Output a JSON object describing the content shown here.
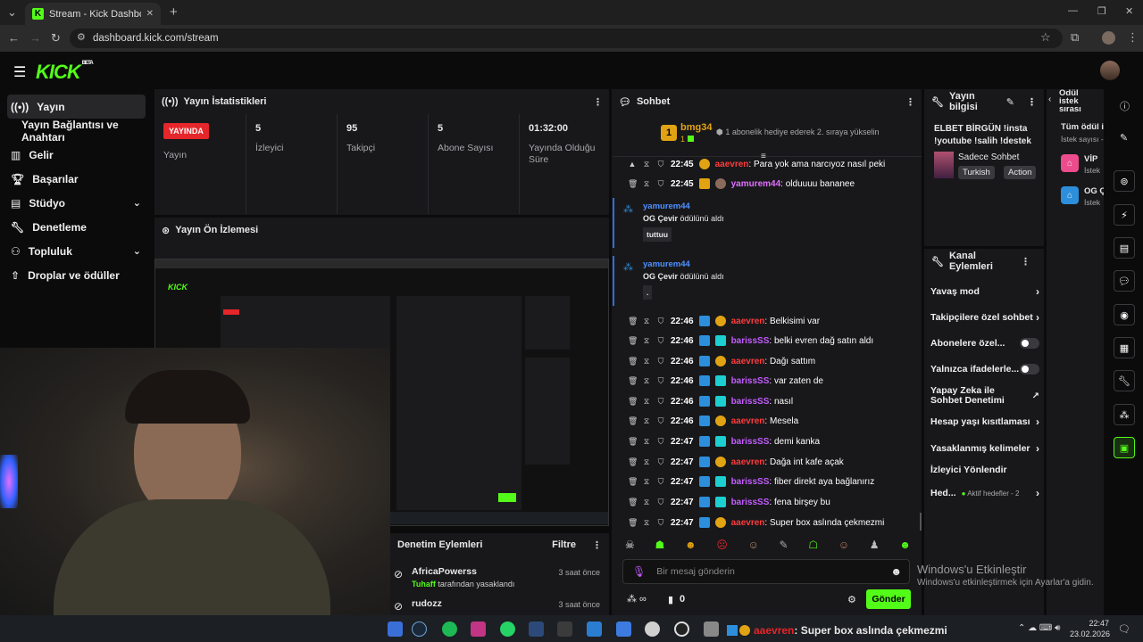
{
  "browser": {
    "tab_title": "Stream - Kick Dashboard",
    "url": "dashboard.kick.com/stream",
    "new_tab": "+",
    "minimize": "—",
    "maximize": "❐",
    "close": "✕"
  },
  "brand": {
    "logo": "KICK",
    "beta": "BETA",
    "accent": "#53fc18"
  },
  "sidebar": {
    "items": [
      {
        "label": "Yayın",
        "icon": "broadcast-icon"
      },
      {
        "label": "Yayın Bağlantısı ve Anahtarı"
      },
      {
        "label": "Gelir",
        "icon": "revenue-icon"
      },
      {
        "label": "Başarılar",
        "icon": "trophy-icon"
      },
      {
        "label": "Stüdyo",
        "icon": "studio-icon"
      },
      {
        "label": "Denetleme",
        "icon": "wrench-icon"
      },
      {
        "label": "Topluluk",
        "icon": "community-icon"
      },
      {
        "label": "Droplar ve ödüller",
        "icon": "drops-icon"
      }
    ]
  },
  "stats": {
    "title": "Yayın İstatistikleri",
    "live_badge": "YAYINDA",
    "items": [
      {
        "value": "",
        "label": "Yayın"
      },
      {
        "value": "5",
        "label": "İzleyici"
      },
      {
        "value": "95",
        "label": "Takipçi"
      },
      {
        "value": "5",
        "label": "Abone Sayısı"
      },
      {
        "value": "01:32:00",
        "label": "Yayında Olduğu Süre"
      }
    ]
  },
  "preview": {
    "title": "Yayın Ön İzlemesi"
  },
  "moderation": {
    "title": "Denetim Eylemleri",
    "filter": "Filtre",
    "entries": [
      {
        "user": "AfricaPowerss",
        "by": "Tuhaff",
        "action": "tarafından yasaklandı",
        "time": "3 saat önce"
      },
      {
        "user": "rudozz",
        "time": "3 saat önce"
      }
    ]
  },
  "chat": {
    "title": "Sohbet",
    "pinned": {
      "rank": "1",
      "user": "bmg34",
      "count": "1",
      "text": "1 abonelik hediye ederek 2. sıraya yükselin"
    },
    "messages": [
      {
        "time": "22:45",
        "user": "aaevren",
        "text": "Para yok ama narcıyoz nasıl peki"
      },
      {
        "time": "22:45",
        "user": "yamurem44",
        "text": "olduuuu bananee"
      },
      {
        "time": "22:46",
        "user": "aaevren",
        "text": "Belkisimi var"
      },
      {
        "time": "22:46",
        "user": "barissSS",
        "text": "belki evren dağ satın aldı"
      },
      {
        "time": "22:46",
        "user": "aaevren",
        "text": "Dağı sattım"
      },
      {
        "time": "22:46",
        "user": "barissSS",
        "text": "var zaten de"
      },
      {
        "time": "22:46",
        "user": "barissSS",
        "text": "nasıl"
      },
      {
        "time": "22:46",
        "user": "aaevren",
        "text": "Mesela"
      },
      {
        "time": "22:47",
        "user": "barissSS",
        "text": "demi kanka"
      },
      {
        "time": "22:47",
        "user": "aaevren",
        "text": "Dağa int kafe açak"
      },
      {
        "time": "22:47",
        "user": "barissSS",
        "text": "fiber direkt aya bağlanırız"
      },
      {
        "time": "22:47",
        "user": "barissSS",
        "text": "fena birşey bu"
      },
      {
        "time": "22:47",
        "user": "aaevren",
        "text": "Super box aslında çekmezmi"
      }
    ],
    "rewards": [
      {
        "user": "yamurem44",
        "reward": "OG Çevir",
        "suffix": "ödülünü aldı",
        "input": "tuttuu"
      },
      {
        "user": "yamurem44",
        "reward": "OG Çevir",
        "suffix": "ödülünü aldı",
        "input": "."
      }
    ],
    "input_placeholder": "Bir mesaj gönderin",
    "points": "0",
    "send": "Gönder"
  },
  "stream_info": {
    "title": "Yayın bilgisi",
    "stream_title": "ELBET BİRGÜN !insta !youtube !salih !destek",
    "category": "Sadece Sohbet",
    "tags": [
      "Turkish",
      "Action"
    ]
  },
  "channel_actions": {
    "title": "Kanal Eylemleri",
    "items": [
      {
        "label": "Yavaş mod",
        "kind": "arrow"
      },
      {
        "label": "Takipçilere özel sohbet",
        "kind": "arrow"
      },
      {
        "label": "Abonelere özel...",
        "kind": "toggle",
        "on": false
      },
      {
        "label": "Yalnızca ifadelerle...",
        "kind": "toggle",
        "on": false
      },
      {
        "label": "Yapay Zeka ile Sohbet Denetimi",
        "kind": "external"
      },
      {
        "label": "Hesap yaşı kısıtlaması",
        "kind": "arrow"
      },
      {
        "label": "Yasaklanmış kelimeler",
        "kind": "arrow"
      },
      {
        "label": "İzleyici Yönlendir",
        "kind": "none"
      },
      {
        "label": "Hed...",
        "kind": "arrow",
        "extra": "Aktif hedefler - 2"
      }
    ]
  },
  "reward_queue": {
    "title": "Ödül istek sırası",
    "all": "Tüm ödül i",
    "sub": "İstek sayısı -",
    "items": [
      {
        "label": "VİP",
        "sub": "İstek"
      },
      {
        "label": "OG Ç",
        "sub": "İstek"
      }
    ]
  },
  "overlay": {
    "activation_title": "Windows'u Etkinleştir",
    "activation_sub": "Windows'u etkinleştirmek için Ayarlar'a gidin."
  },
  "taskbar": {
    "ticker_user": "aaevren",
    "ticker_text": ": Super box aslında çekmezmi",
    "time": "22:47",
    "date": "23.02.2026"
  }
}
